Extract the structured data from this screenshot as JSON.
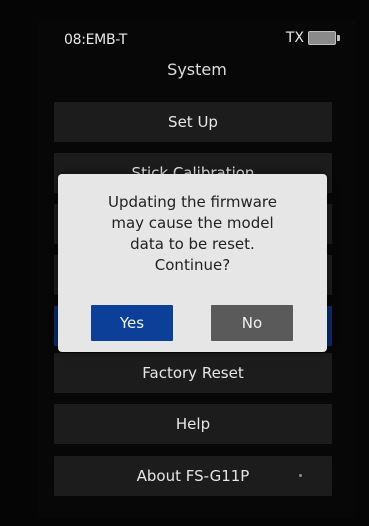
{
  "status": {
    "left_text": "08:EMB-T",
    "right_text": "TX",
    "battery_icon": "battery-icon"
  },
  "header": {
    "title": "System"
  },
  "menu": {
    "items": [
      {
        "label": "Set Up"
      },
      {
        "label": "Stick Calibration"
      },
      {
        "label": ""
      },
      {
        "label": ""
      },
      {
        "label": ""
      },
      {
        "label": "Factory Reset"
      },
      {
        "label": "Help"
      },
      {
        "label": "About FS-G11P"
      }
    ]
  },
  "dialog": {
    "message": "Updating the firmware\nmay cause the model\ndata to be reset.\nContinue?",
    "yes_label": "Yes",
    "no_label": "No"
  },
  "colors": {
    "background": "#070707",
    "menu_item": "#1c1c1c",
    "selected_item": "#0a2c6c",
    "dialog_bg": "#e6e6e6",
    "yes_button": "#0c3f97",
    "no_button": "#5a5a5a"
  }
}
